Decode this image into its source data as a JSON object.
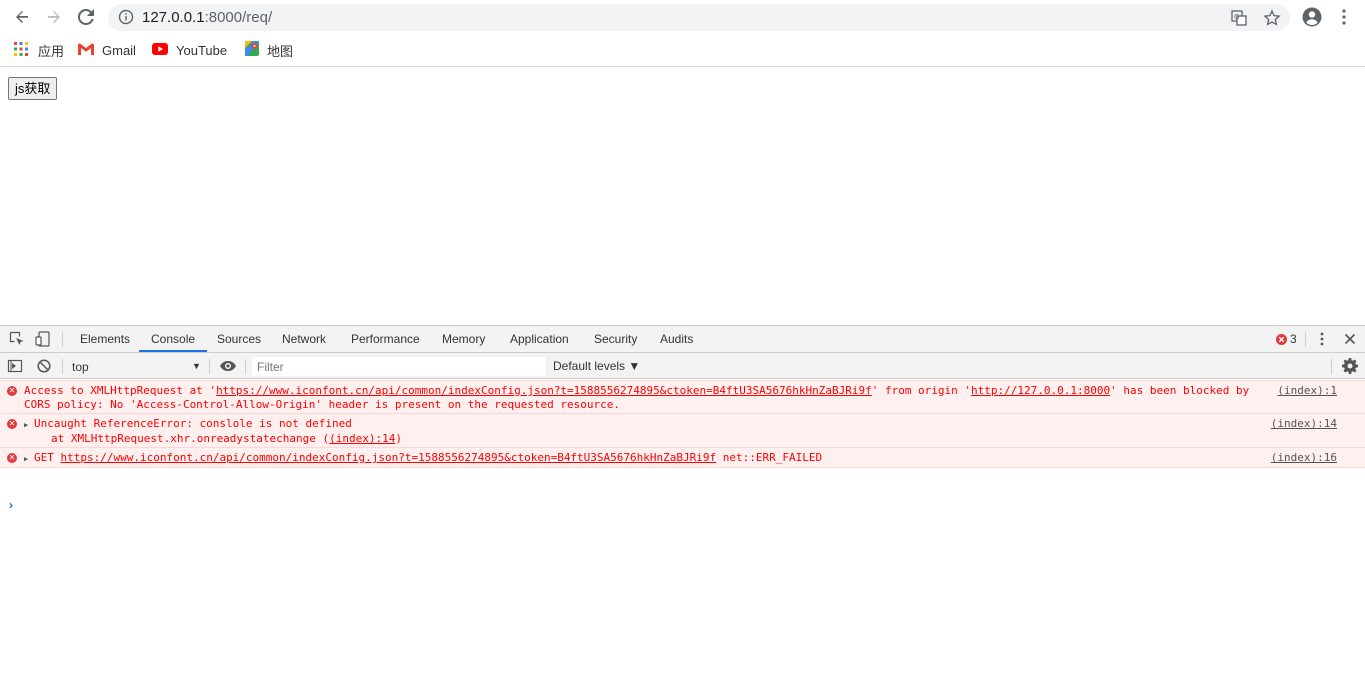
{
  "browser": {
    "url_host": "127.0.0.1",
    "url_rest": ":8000/req/",
    "bookmarks": [
      {
        "label": "应用",
        "icon": "apps-grid-icon"
      },
      {
        "label": "Gmail",
        "icon": "gmail-icon"
      },
      {
        "label": "YouTube",
        "icon": "youtube-icon"
      },
      {
        "label": "地图",
        "icon": "maps-icon"
      }
    ]
  },
  "page": {
    "button_label": "js获取"
  },
  "devtools": {
    "tabs": [
      "Elements",
      "Console",
      "Sources",
      "Network",
      "Performance",
      "Memory",
      "Application",
      "Security",
      "Audits"
    ],
    "active_tab": "Console",
    "error_count": "3",
    "context": "top",
    "filter_placeholder": "Filter",
    "levels_label": "Default levels ▼",
    "messages": [
      {
        "prefix": "Access to XMLHttpRequest at '",
        "link1": "https://www.iconfont.cn/api/common/indexConfig.json?t=1588556274895&ctoken=B4ftU3SA5676hkHnZaBJRi9f",
        "middle": "' from origin '",
        "link2": "http://127.0.0.1:8000",
        "suffix": "' has been blocked by",
        "line2": "CORS policy: No 'Access-Control-Allow-Origin' header is present on the requested resource.",
        "source": "(index):1"
      },
      {
        "line1": "Uncaught ReferenceError: conslole is not defined",
        "line2_prefix": "at XMLHttpRequest.xhr.onreadystatechange (",
        "line2_link": "(index):14",
        "line2_suffix": ")",
        "source": "(index):14"
      },
      {
        "prefix": "GET ",
        "link": "https://www.iconfont.cn/api/common/indexConfig.json?t=1588556274895&ctoken=B4ftU3SA5676hkHnZaBJRi9f",
        "suffix": " net::ERR_FAILED",
        "source": "(index):16"
      }
    ],
    "prompt_symbol": "›"
  },
  "colors": {
    "accent": "#1a73e8",
    "error_text": "#ff0000",
    "error_bg": "#fff0f0",
    "error_icon": "#e0393e"
  }
}
